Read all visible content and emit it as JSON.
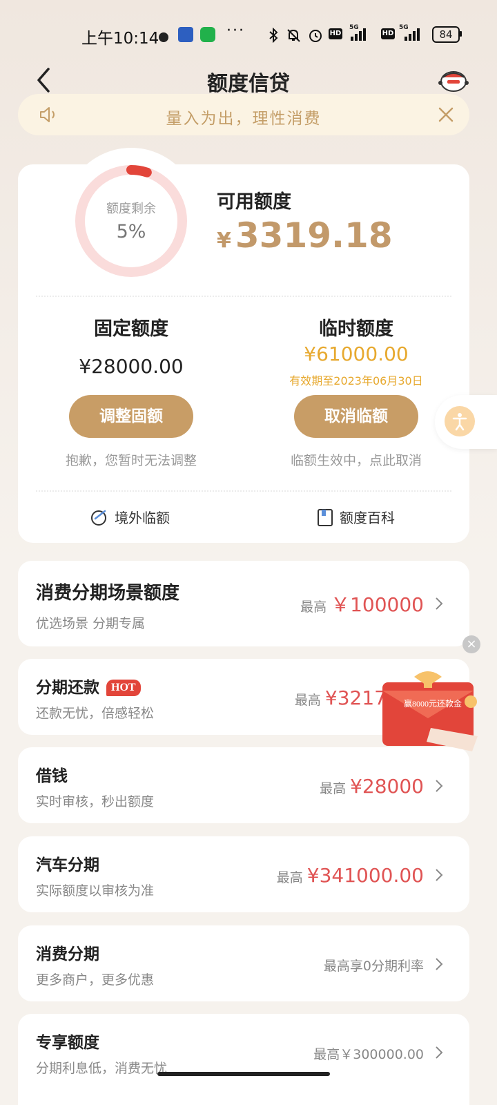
{
  "status_bar": {
    "time": "上午10:14",
    "more": "···",
    "battery": "84",
    "net_5g": "5G",
    "hd": "HD"
  },
  "header": {
    "title": "额度信贷"
  },
  "notice": {
    "text": "量入为出，理性消费"
  },
  "quota": {
    "ring_label": "额度剩余",
    "ring_value": "5%",
    "ring_fraction": 0.05,
    "available_label": "可用额度",
    "available_currency": "¥",
    "available_amount": "3319.18"
  },
  "fixed": {
    "label": "固定额度",
    "amount": "¥28000.00",
    "button": "调整固额",
    "hint": "抱歉，您暂时无法调整"
  },
  "temporary": {
    "label": "临时额度",
    "amount": "¥61000.00",
    "validity": "有效期至2023年06月30日",
    "button": "取消临额",
    "hint": "临额生效中，点此取消"
  },
  "links": {
    "overseas": "境外临额",
    "wiki": "额度百科"
  },
  "products": [
    {
      "title": "消费分期场景额度",
      "subtitle": "优选场景 分期专属",
      "prefix": "最高",
      "amount": "￥100000"
    },
    {
      "title": "分期还款",
      "badge": "HOT",
      "subtitle": "还款无忧，倍感轻松",
      "prefix": "最高",
      "amount": "¥3217"
    },
    {
      "title": "借钱",
      "subtitle": "实时审核，秒出额度",
      "prefix": "最高",
      "amount": "¥28000"
    },
    {
      "title": "汽车分期",
      "subtitle": "实际额度以审核为准",
      "prefix": "最高",
      "amount": "¥341000.00"
    },
    {
      "title": "消费分期",
      "subtitle": "更多商户，更多优惠",
      "prefix": "最高享0分期利率",
      "amount": ""
    },
    {
      "title": "专享额度",
      "subtitle": "分期利息低，消费无忧",
      "prefix": "最高￥300000.00",
      "amount": ""
    }
  ],
  "promo": {
    "text": "赢8000元还款金",
    "close": "×"
  },
  "colors": {
    "accent_gold": "#c89d66",
    "amount_red": "#e05454",
    "temp_yellow": "#e7a92f",
    "ring_red": "#e2453a"
  }
}
